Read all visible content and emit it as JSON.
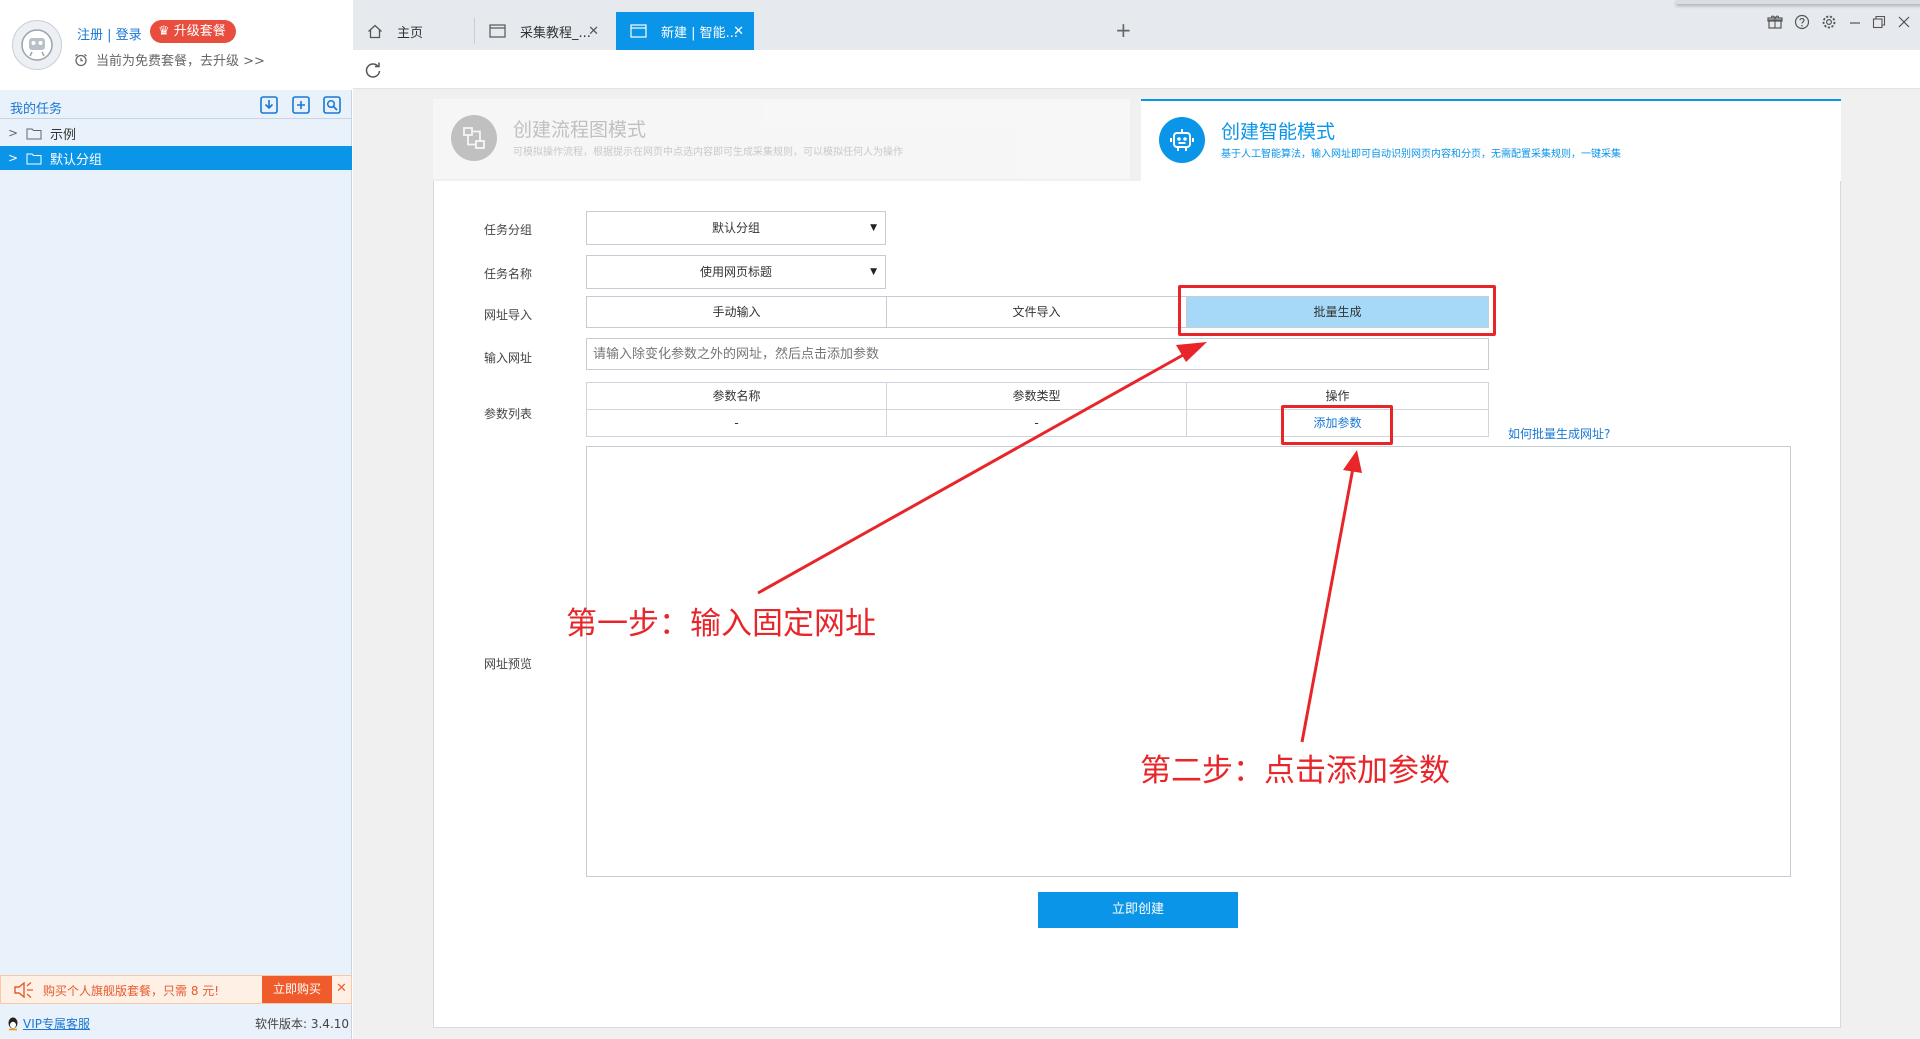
{
  "user": {
    "auth_links": "注册 | 登录",
    "upgrade_label": "升级套餐",
    "plan_text": "当前为免费套餐，去升级 >>"
  },
  "sidebar": {
    "title": "我的任务",
    "tree": [
      {
        "label": "示例",
        "selected": false
      },
      {
        "label": "默认分组",
        "selected": true
      }
    ],
    "promo_text": "购买个人旗舰版套餐，只需 8 元!",
    "promo_button": "立即购买",
    "vip_link": "VIP专属客服",
    "version": "软件版本: 3.4.10"
  },
  "tabs": [
    {
      "label": "主页",
      "icon": "home-icon",
      "active": false
    },
    {
      "label": "采集教程_...",
      "icon": "window-icon",
      "active": false
    },
    {
      "label": "新建 | 智能...",
      "icon": "window-icon",
      "active": true
    }
  ],
  "modes": {
    "flow": {
      "title": "创建流程图模式",
      "desc": "可模拟操作流程，根据提示在网页中点选内容即可生成采集规则，可以模拟任何人为操作"
    },
    "smart": {
      "title": "创建智能模式",
      "desc": "基于人工智能算法，输入网址即可自动识别网页内容和分页，无需配置采集规则，一键采集"
    }
  },
  "form": {
    "group_label": "任务分组",
    "group_value": "默认分组",
    "name_label": "任务名称",
    "name_value": "使用网页标题",
    "import_label": "网址导入",
    "import_options": [
      "手动输入",
      "文件导入",
      "批量生成"
    ],
    "import_selected": "批量生成",
    "input_label": "输入网址",
    "input_placeholder": "请输入除变化参数之外的网址，然后点击添加参数",
    "params_label": "参数列表",
    "params_headers": [
      "参数名称",
      "参数类型",
      "操作"
    ],
    "params_row": [
      "-",
      "-",
      "添加参数"
    ],
    "help_link": "如何批量生成网址?",
    "preview_label": "网址预览",
    "create_button": "立即创建"
  },
  "annotations": {
    "step1": "第一步：输入固定网址",
    "step2": "第二步：点击添加参数",
    "color": "#e8262a"
  },
  "colors": {
    "accent": "#0b95e8",
    "link": "#1a78d3",
    "promo": "#f05b2b"
  }
}
